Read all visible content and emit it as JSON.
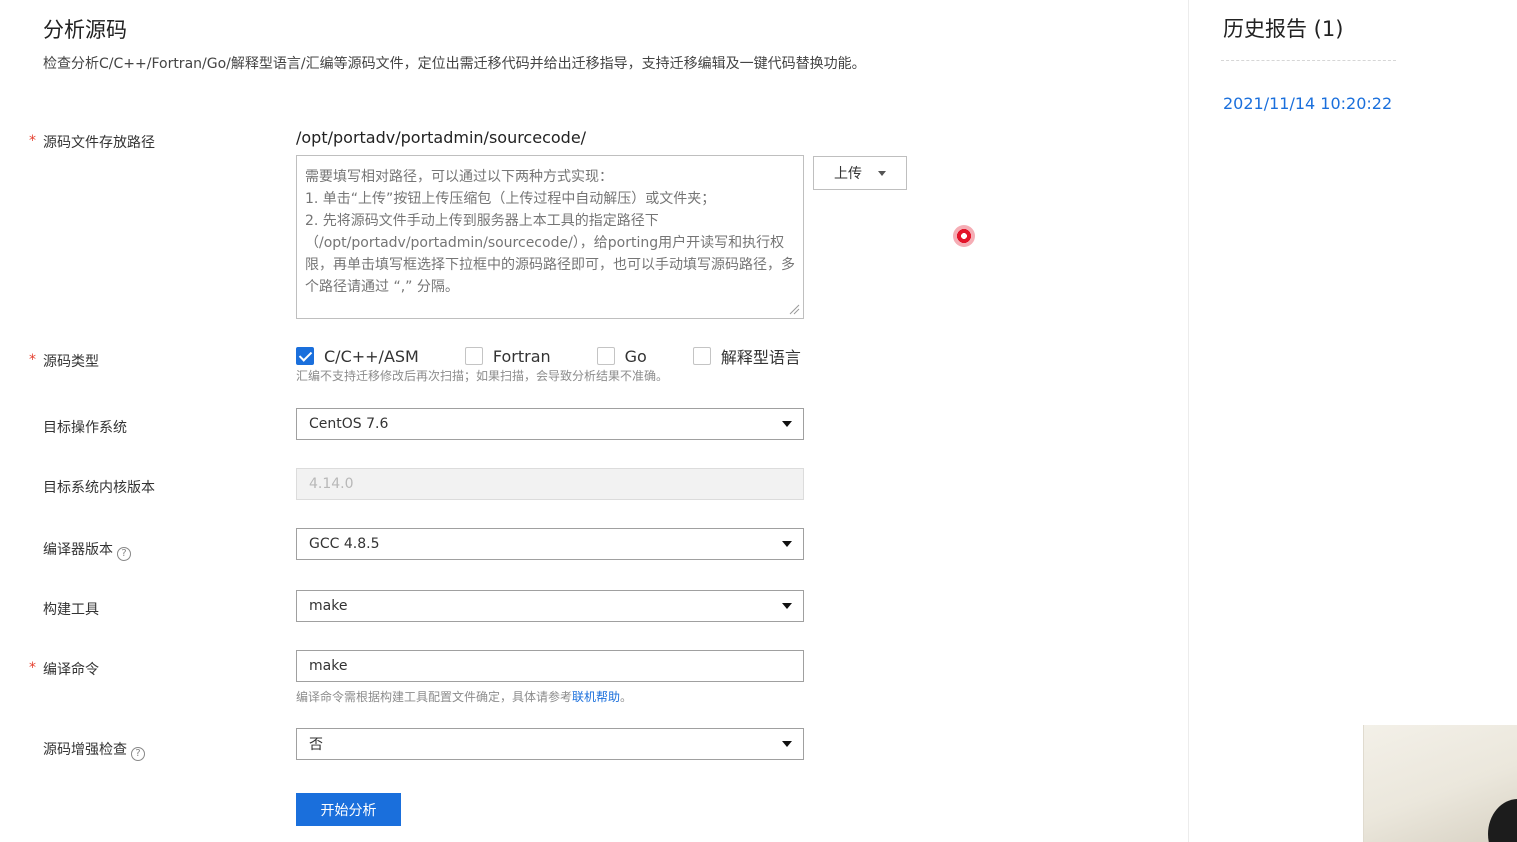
{
  "page": {
    "title": "分析源码",
    "description": "检查分析C/C++/Fortran/Go/解释型语言/汇编等源码文件，定位出需迁移代码并给出迁移指导，支持迁移编辑及一键代码替换功能。"
  },
  "form": {
    "required_mark": "*",
    "source_path": {
      "label": "源码文件存放路径",
      "value": "/opt/portadv/portadmin/sourcecode/",
      "placeholder": "需要填写相对路径，可以通过以下两种方式实现：\n1. 单击“上传”按钮上传压缩包（上传过程中自动解压）或文件夹；\n2. 先将源码文件手动上传到服务器上本工具的指定路径下（/opt/portadv/portadmin/sourcecode/），给porting用户开读写和执行权限，再单击填写框选择下拉框中的源码路径即可，也可以手动填写源码路径，多个路径请通过 “,” 分隔。",
      "upload_label": "上传"
    },
    "source_type": {
      "label": "源码类型",
      "options": [
        {
          "label": "C/C++/ASM",
          "checked": true
        },
        {
          "label": "Fortran",
          "checked": false
        },
        {
          "label": "Go",
          "checked": false
        },
        {
          "label": "解释型语言",
          "checked": false
        }
      ],
      "hint": "汇编不支持迁移修改后再次扫描；如果扫描，会导致分析结果不准确。"
    },
    "target_os": {
      "label": "目标操作系统",
      "value": "CentOS 7.6"
    },
    "kernel_version": {
      "label": "目标系统内核版本",
      "value": "4.14.0"
    },
    "compiler_version": {
      "label": "编译器版本",
      "value": "GCC 4.8.5",
      "help": "?"
    },
    "build_tool": {
      "label": "构建工具",
      "value": "make"
    },
    "compile_command": {
      "label": "编译命令",
      "value": "make",
      "hint_prefix": "编译命令需根据构建工具配置文件确定，具体请参考",
      "hint_link": "联机帮助",
      "hint_suffix": "。"
    },
    "enhanced_check": {
      "label": "源码增强检查",
      "value": "否",
      "help": "?"
    },
    "submit_label": "开始分析"
  },
  "history": {
    "title": "历史报告 (1)",
    "items": [
      "2021/11/14 10:20:22"
    ]
  },
  "colors": {
    "primary": "#1a6fdc",
    "required": "#e5402f",
    "recording": "#e3142a"
  }
}
